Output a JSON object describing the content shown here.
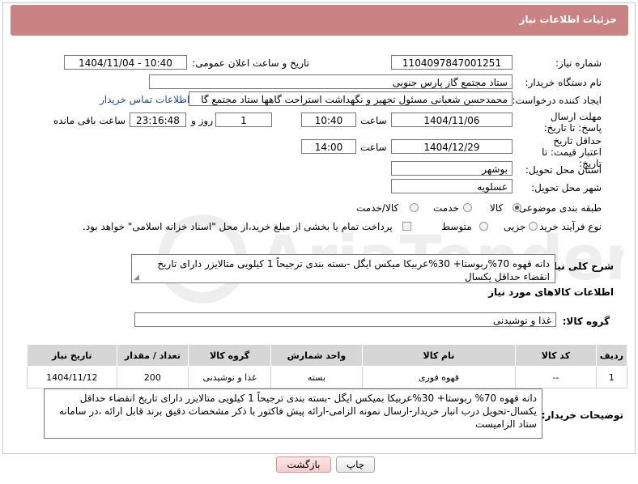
{
  "header": {
    "title": "جزئیات اطلاعات نیاز"
  },
  "form": {
    "need_number_label": "شماره نیاز:",
    "need_number": "1104097847001251",
    "announce_label": "تاریخ و ساعت اعلان عمومی:",
    "announce_value": "1404/11/04 - 10:40",
    "buyer_org_label": "نام دستگاه خریدار:",
    "buyer_org": "ستاد مجتمع گاز پارس جنوبی",
    "creator_label": "ایجاد کننده درخواست:",
    "creator": "محمدحسن شعبانی مسئول تجهیز و نگهداشت استراحت گاهها ستاد مجتمع گا",
    "contact_link": "اطلاعات تماس خریدار",
    "deadline_label": "مهلت ارسال پاسخ: تا تاریخ:",
    "deadline_date": "1404/11/06",
    "time_label": "ساعت",
    "deadline_time": "10:40",
    "days_value": "1",
    "days_label": "روز و",
    "remaining_time": "23:16:48",
    "remaining_label": "ساعت باقی مانده",
    "validity_label": "حداقل تاریخ اعتبار قیمت: تا تاریخ:",
    "validity_date": "1404/12/29",
    "validity_time_label": "ساعت",
    "validity_time": "14:00",
    "province_label": "استان محل تحویل:",
    "province": "بوشهر",
    "city_label": "شهر محل تحویل:",
    "city": "عسلویه",
    "category_label": "طبقه بندی موضوعی:",
    "category_options": [
      "کالا",
      "خدمت",
      "کالا/خدمت"
    ],
    "category_selected": "کالا",
    "process_label": "نوع فرآیند خرید :",
    "process_options": [
      "جزیی",
      "متوسط"
    ],
    "payment_note": "پرداخت تمام یا بخشی از مبلغ خرید،از محل \"اسناد خزانه اسلامی\" خواهد بود.",
    "summary_label": "شرح کلی نیاز:",
    "summary": "دانه قهوه 70%ربوستا+ 30%عربیکا میکس ایگل -بسته بندی ترجیحاً 1 کیلویی متالایزر دارای تاریخ انقضاء حداقل یکسال"
  },
  "goods": {
    "section_title": "اطلاعات کالاهای مورد نیاز",
    "group_label": "گروه کالا:",
    "group_value": "غذا و نوشیدنی",
    "columns": [
      "ردیف",
      "کد کالا",
      "نام کالا",
      "واحد شمارش",
      "گروه کالا",
      "تعداد / مقدار",
      "تاریخ نیاز"
    ],
    "rows": [
      {
        "row": "1",
        "code": "--",
        "name": "قهوه فوری",
        "unit": "بسته",
        "group": "غذا و نوشیدنی",
        "qty": "200",
        "date": "1404/11/12"
      }
    ]
  },
  "buyer_notes": {
    "label": "توضیحات خریدار:",
    "text": "دانه قهوه 70% ربوستا+ 30%عربیکا بمیکس ایگل -بسته بندی ترجیحاً 1 کیلویی متالایزر دارای تاریخ انقضاء حداقل یکسال-تحویل درب انبار خریدار-ارسال نمونه الزامی-ارائه پیش فاکتور با ذکر مشخصات دقیق برند قابل ارائه ،در سامانه ستاد الزامیست"
  },
  "buttons": {
    "print": "چاپ",
    "back": "بازگشت"
  },
  "colors": {
    "header_bg": "#c98383",
    "link": "#1a4fa0",
    "table_header": "#d6d6d6"
  }
}
